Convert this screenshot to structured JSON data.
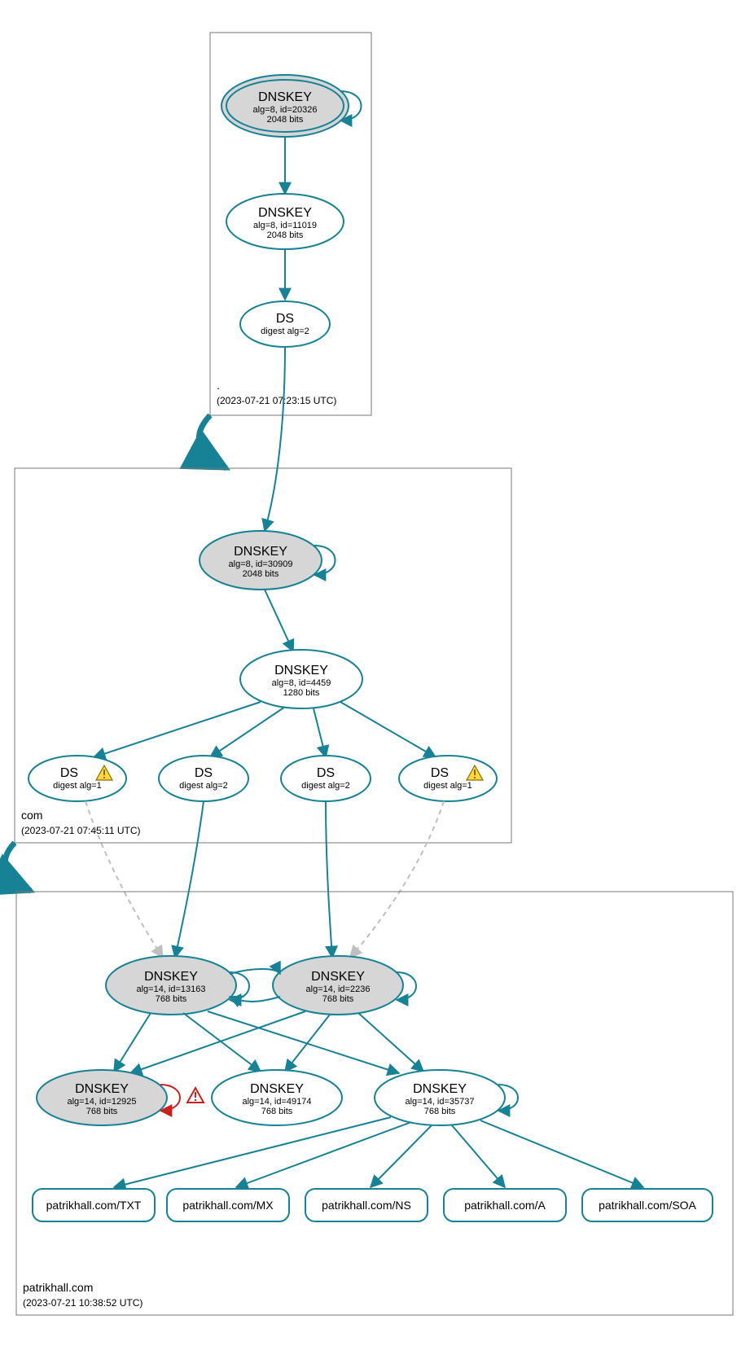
{
  "zones": {
    "root": {
      "label": ".",
      "timestamp": "(2023-07-21 07:23:15 UTC)"
    },
    "com": {
      "label": "com",
      "timestamp": "(2023-07-21 07:45:11 UTC)"
    },
    "leaf": {
      "label": "patrikhall.com",
      "timestamp": "(2023-07-21 10:38:52 UTC)"
    }
  },
  "nodes": {
    "root_ksk": {
      "title": "DNSKEY",
      "sub1": "alg=8, id=20326",
      "sub2": "2048 bits"
    },
    "root_zsk": {
      "title": "DNSKEY",
      "sub1": "alg=8, id=11019",
      "sub2": "2048 bits"
    },
    "root_ds": {
      "title": "DS",
      "sub1": "digest alg=2"
    },
    "com_ksk": {
      "title": "DNSKEY",
      "sub1": "alg=8, id=30909",
      "sub2": "2048 bits"
    },
    "com_zsk": {
      "title": "DNSKEY",
      "sub1": "alg=8, id=4459",
      "sub2": "1280 bits"
    },
    "com_ds1": {
      "title": "DS",
      "sub1": "digest alg=1"
    },
    "com_ds2": {
      "title": "DS",
      "sub1": "digest alg=2"
    },
    "com_ds3": {
      "title": "DS",
      "sub1": "digest alg=2"
    },
    "com_ds4": {
      "title": "DS",
      "sub1": "digest alg=1"
    },
    "leaf_ksk1": {
      "title": "DNSKEY",
      "sub1": "alg=14, id=13163",
      "sub2": "768 bits"
    },
    "leaf_ksk2": {
      "title": "DNSKEY",
      "sub1": "alg=14, id=2236",
      "sub2": "768 bits"
    },
    "leaf_k3": {
      "title": "DNSKEY",
      "sub1": "alg=14, id=12925",
      "sub2": "768 bits"
    },
    "leaf_k4": {
      "title": "DNSKEY",
      "sub1": "alg=14, id=49174",
      "sub2": "768 bits"
    },
    "leaf_k5": {
      "title": "DNSKEY",
      "sub1": "alg=14, id=35737",
      "sub2": "768 bits"
    }
  },
  "rrsets": {
    "txt": "patrikhall.com/TXT",
    "mx": "patrikhall.com/MX",
    "ns": "patrikhall.com/NS",
    "a": "patrikhall.com/A",
    "soa": "patrikhall.com/SOA"
  },
  "colors": {
    "stroke": "#178196",
    "nodefill_sep": "#d6d6d6",
    "nodefill_plain": "#ffffff",
    "zoneborder": "#777777",
    "dashed": "#bfbfbf",
    "error": "#cc2020",
    "warn_fill": "#ffd83a",
    "warn_stroke": "#8a6d00"
  }
}
